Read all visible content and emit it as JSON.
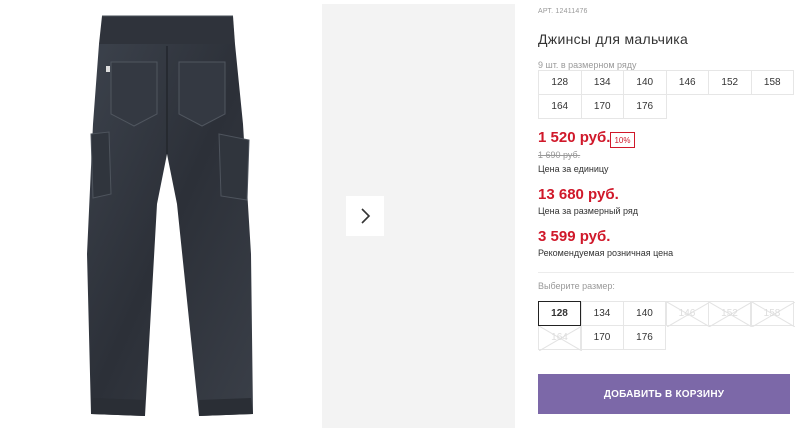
{
  "product": {
    "sku": "АРТ. 12411476",
    "title": "Джинсы для мальчика",
    "row_note": "9 шт. в размерном ряду",
    "row_sizes": [
      [
        "128",
        "134",
        "140",
        "146",
        "152",
        "158"
      ],
      [
        "164",
        "170",
        "176"
      ]
    ]
  },
  "prices": {
    "unit_price": "1 520 руб.",
    "discount": "10%",
    "old_price": "1 690 руб.",
    "unit_label": "Цена за единицу",
    "row_price": "13 680 руб.",
    "row_label": "Цена за размерный ряд",
    "rrp_price": "3 599 руб.",
    "rrp_label": "Рекомендуемая розничная цена",
    "price_color": "#d0182a"
  },
  "size_picker": {
    "label": "Выберите размер:",
    "sizes": [
      {
        "label": "128",
        "state": "selected"
      },
      {
        "label": "134",
        "state": "available"
      },
      {
        "label": "140",
        "state": "available"
      },
      {
        "label": "146",
        "state": "unavailable"
      },
      {
        "label": "152",
        "state": "unavailable"
      },
      {
        "label": "158",
        "state": "unavailable"
      },
      {
        "label": "164",
        "state": "unavailable"
      },
      {
        "label": "170",
        "state": "available"
      },
      {
        "label": "176",
        "state": "available"
      }
    ]
  },
  "cart": {
    "button_label": "ДОБАВИТЬ В КОРЗИНУ",
    "button_color": "#7c68a8"
  },
  "gallery": {
    "image_icon": "jeans-product-photo",
    "next_icon": "chevron-right-icon"
  }
}
